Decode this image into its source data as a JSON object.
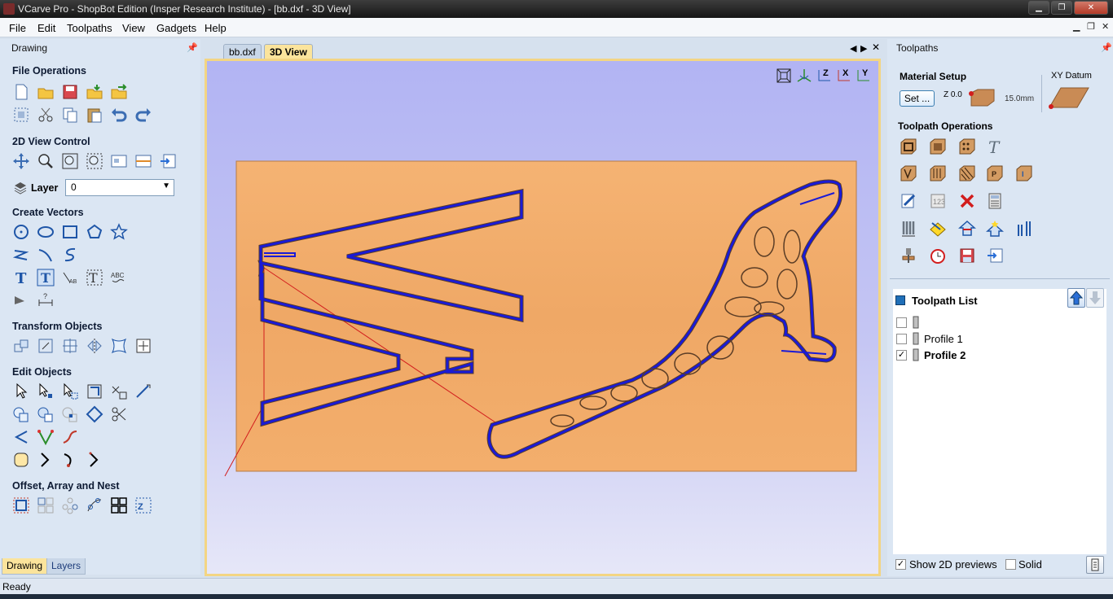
{
  "window": {
    "title": "VCarve Pro - ShopBot Edition (Insper Research Institute) - [bb.dxf - 3D View]",
    "min_icon": "minimize-icon",
    "max_icon": "maximize-icon",
    "close_icon": "close-icon"
  },
  "menu": {
    "items": [
      "File",
      "Edit",
      "Toolpaths",
      "View",
      "Gadgets",
      "Help"
    ]
  },
  "left_panel": {
    "title": "Drawing",
    "sections": {
      "file_operations": "File Operations",
      "view_control": "2D View Control",
      "layer_label": "Layer",
      "layer_value": "0",
      "create_vectors": "Create Vectors",
      "transform_objects": "Transform Objects",
      "edit_objects": "Edit Objects",
      "offset_array": "Offset, Array and Nest"
    },
    "bottom_tabs": [
      "Drawing",
      "Layers"
    ]
  },
  "document": {
    "tabs": [
      "bb.dxf",
      "3D View"
    ],
    "active_tab": "3D View",
    "view_buttons": [
      "zoom-extents-icon",
      "iso-view-icon",
      "z-view-icon",
      "x-view-icon",
      "y-view-icon"
    ],
    "view_labels": [
      "Z",
      "X",
      "Y"
    ]
  },
  "right_panel": {
    "title": "Toolpaths",
    "material_setup": "Material Setup",
    "xy_datum": "XY Datum",
    "set_button": "Set ...",
    "z_zero": "Z 0.0",
    "thickness": "15.0mm",
    "toolpath_operations": "Toolpath Operations",
    "toolpath_list_title": "Toolpath List",
    "toolpaths": [
      {
        "label": "",
        "checked": false
      },
      {
        "label": "Profile 1",
        "checked": false
      },
      {
        "label": "Profile 2",
        "checked": true
      }
    ],
    "show_2d_previews": "Show 2D previews",
    "show_2d_checked": true,
    "solid": "Solid",
    "solid_checked": false
  },
  "status": {
    "text": "Ready"
  },
  "colors": {
    "material": "#f0a865",
    "toolpath": "#1a1ad6",
    "view_bg_top": "#b2b4f3",
    "panel_bg": "#dbe6f3",
    "active_tab": "#fbe49c"
  }
}
